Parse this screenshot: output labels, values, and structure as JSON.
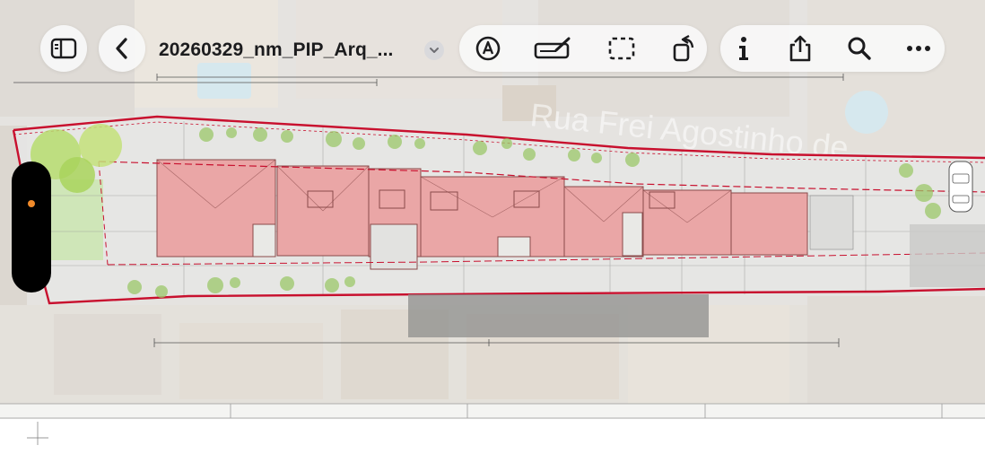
{
  "document": {
    "title": "20260329_nm_PIP_Arq_..."
  },
  "map": {
    "street_label": "Rua Frei Agostinho de"
  },
  "toolbar": {
    "sidebar_icon": "sidebar-toggle-icon",
    "back_icon": "chevron-left-icon",
    "title_dropdown_icon": "chevron-down-icon",
    "tools": [
      {
        "name": "markup-icon"
      },
      {
        "name": "signature-icon"
      },
      {
        "name": "select-area-icon"
      },
      {
        "name": "rotate-icon"
      }
    ],
    "actions": [
      {
        "name": "info-icon"
      },
      {
        "name": "share-icon"
      },
      {
        "name": "search-icon"
      },
      {
        "name": "more-icon"
      }
    ]
  },
  "colors": {
    "building_fill": "#eaa6a6",
    "boundary_red": "#c8102e",
    "handle_dot": "#f08a2a"
  }
}
